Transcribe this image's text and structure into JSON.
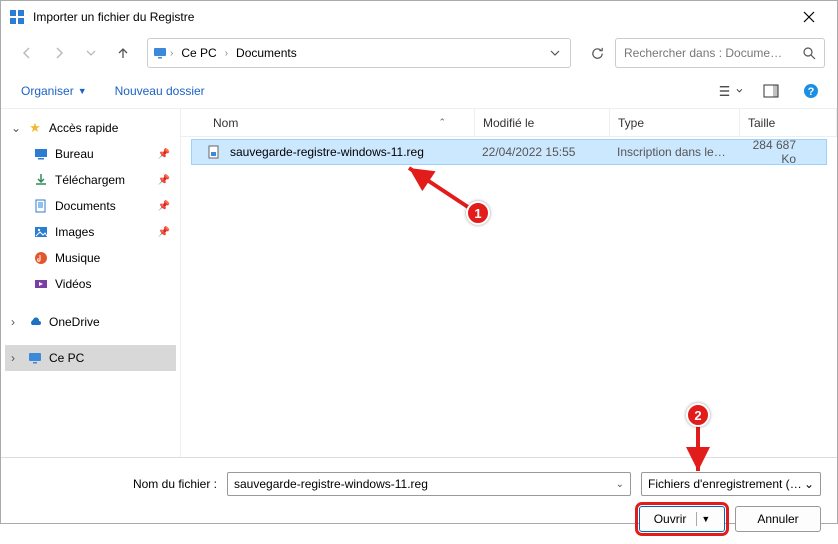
{
  "window": {
    "title": "Importer un fichier du Registre"
  },
  "breadcrumb": {
    "pc": "Ce PC",
    "folder": "Documents"
  },
  "search": {
    "placeholder": "Rechercher dans : Docume…"
  },
  "toolbar": {
    "organize": "Organiser",
    "new_folder": "Nouveau dossier"
  },
  "sidebar": {
    "quick": "Accès rapide",
    "desktop": "Bureau",
    "downloads": "Téléchargem",
    "documents": "Documents",
    "images": "Images",
    "music": "Musique",
    "videos": "Vidéos",
    "onedrive": "OneDrive",
    "thispc": "Ce PC"
  },
  "columns": {
    "name": "Nom",
    "modified": "Modifié le",
    "type": "Type",
    "size": "Taille"
  },
  "files": [
    {
      "name": "sauvegarde-registre-windows-11.reg",
      "modified": "22/04/2022 15:55",
      "type": "Inscription dans le…",
      "size": "284 687 Ko"
    }
  ],
  "footer": {
    "filename_label": "Nom du fichier :",
    "filename_value": "sauvegarde-registre-windows-11.reg",
    "filter": "Fichiers d'enregistrement (*.reg",
    "open": "Ouvrir",
    "cancel": "Annuler"
  },
  "annotations": {
    "b1": "1",
    "b2": "2"
  }
}
